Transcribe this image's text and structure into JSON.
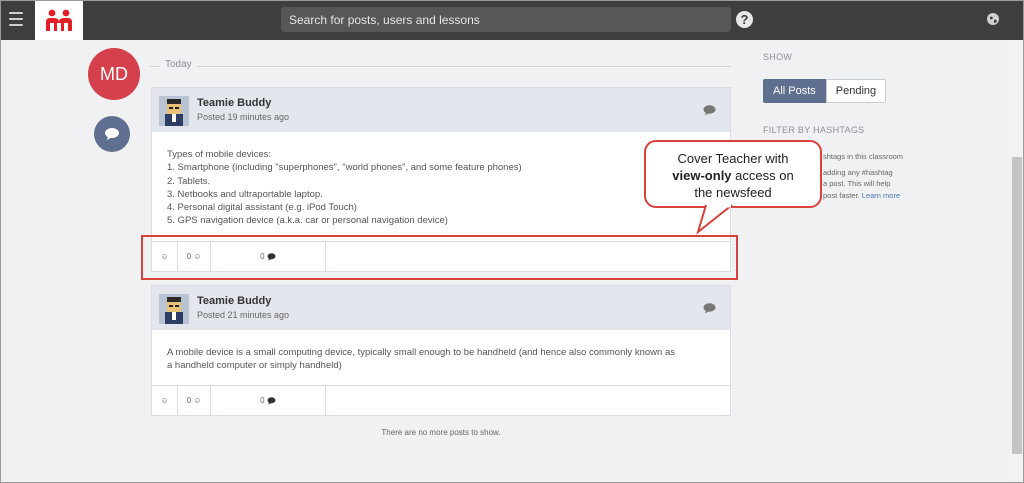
{
  "topbar": {
    "search_placeholder": "Search for posts, users and lessons",
    "help_glyph": "?"
  },
  "user": {
    "initials": "MD"
  },
  "feed": {
    "date_label": "Today",
    "posts": [
      {
        "author": "Teamie Buddy",
        "time": "Posted 19 minutes ago",
        "body": [
          "Types of mobile devices:",
          "1. Smartphone (including \"superphones\", \"world phones\", and some feature phones)",
          "2. Tablets.",
          "3. Netbooks and ultraportable laptop.",
          "4. Personal digital assistant (e.g. iPod Touch)",
          "5. GPS navigation device (a.k.a. car or personal navigation device)"
        ],
        "reactions": "0",
        "comments": "0"
      },
      {
        "author": "Teamie Buddy",
        "time": "Posted 21 minutes ago",
        "body": [
          "A mobile device is a small computing device, typically small enough to be handheld (and hence also commonly known as",
          "a handheld computer or simply handheld)"
        ],
        "reactions": "0",
        "comments": "0"
      }
    ],
    "no_more": "There are no more posts to show."
  },
  "sidebar": {
    "show_label": "SHOW",
    "tabs": [
      "All Posts",
      "Pending"
    ],
    "hashtag_label": "FILTER BY HASHTAGS",
    "hashtag_line1": "shtags in this classroom",
    "hashtag_line2a": "adding any #hashtag",
    "hashtag_line2b": "a post. This will help",
    "hashtag_line2c": "post faster.",
    "learn_more": "Learn more"
  },
  "annotation": {
    "line1": "Cover Teacher with",
    "bold": "view-only",
    "line2_rest": " access on",
    "line3": "the newsfeed"
  },
  "colors": {
    "topbar": "#3e3e3e",
    "accent": "#5e6f8f",
    "avatar": "#d4404b",
    "annotation": "#d8403c"
  },
  "icons": {
    "menu": "hamburger-icon",
    "logo": "teamie-logo",
    "help": "help-icon",
    "globe": "globe-icon",
    "chat": "chat-bubble-icon",
    "smiley": "smiley-icon"
  }
}
